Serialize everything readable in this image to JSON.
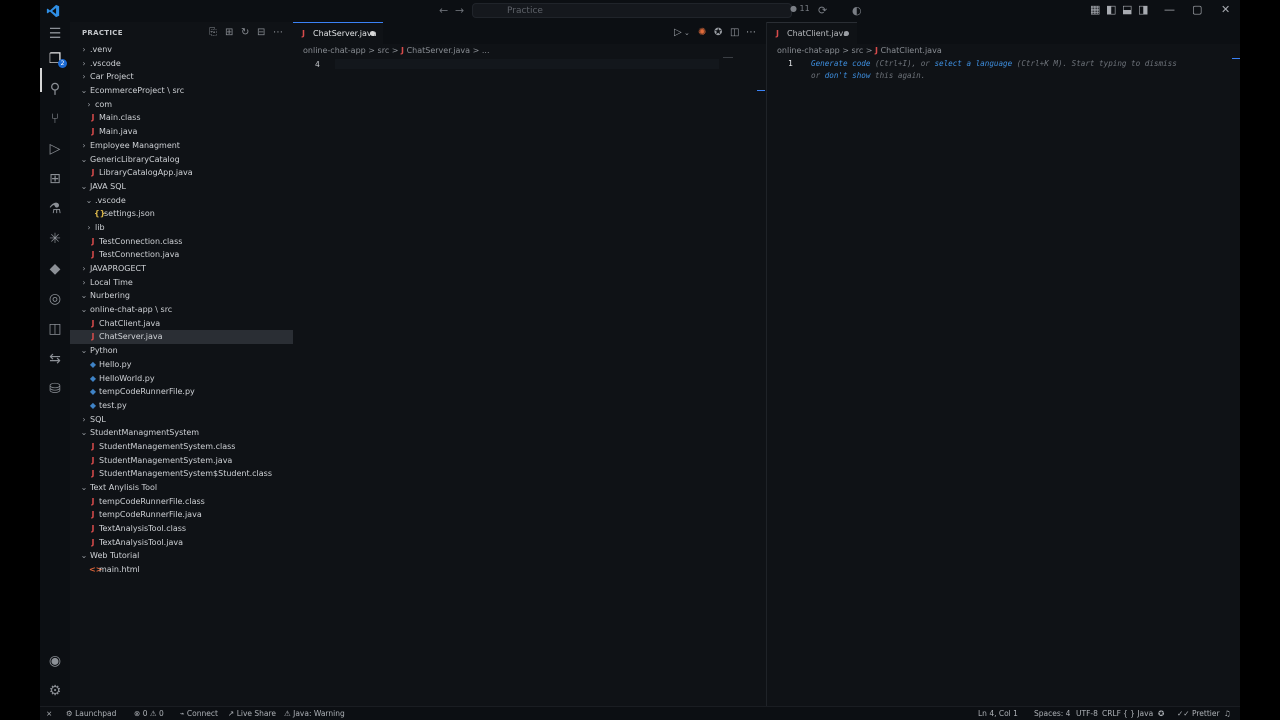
{
  "titlebar": {
    "search_placeholder": "Practice",
    "notifications_count": "11"
  },
  "sidebar": {
    "title": "PRACTICE",
    "items": [
      {
        "label": ".venv",
        "type": "folder",
        "state": "closed",
        "depth": 0
      },
      {
        "label": ".vscode",
        "type": "folder",
        "state": "closed",
        "depth": 0
      },
      {
        "label": "Car Project",
        "type": "folder",
        "state": "closed",
        "depth": 0
      },
      {
        "label": "EcommerceProject \\ src",
        "type": "folder",
        "state": "open",
        "depth": 0
      },
      {
        "label": "com",
        "type": "folder",
        "state": "closed",
        "depth": 1
      },
      {
        "label": "Main.class",
        "type": "java",
        "depth": 1
      },
      {
        "label": "Main.java",
        "type": "java",
        "depth": 1
      },
      {
        "label": "Employee Managment",
        "type": "folder",
        "state": "closed",
        "depth": 0
      },
      {
        "label": "GenericLibraryCatalog",
        "type": "folder",
        "state": "open",
        "depth": 0
      },
      {
        "label": "LibraryCatalogApp.java",
        "type": "java",
        "depth": 1
      },
      {
        "label": "JAVA SQL",
        "type": "folder",
        "state": "open",
        "depth": 0
      },
      {
        "label": ".vscode",
        "type": "folder",
        "state": "open",
        "depth": 1
      },
      {
        "label": "settings.json",
        "type": "json",
        "depth": 2
      },
      {
        "label": "lib",
        "type": "folder",
        "state": "closed",
        "depth": 1
      },
      {
        "label": "TestConnection.class",
        "type": "java",
        "depth": 1
      },
      {
        "label": "TestConnection.java",
        "type": "java",
        "depth": 1
      },
      {
        "label": "JAVAPROGECT",
        "type": "folder",
        "state": "closed",
        "depth": 0
      },
      {
        "label": "Local Time",
        "type": "folder",
        "state": "closed",
        "depth": 0
      },
      {
        "label": "Nurbering",
        "type": "folder",
        "state": "open",
        "depth": 0
      },
      {
        "label": "online-chat-app \\ src",
        "type": "folder",
        "state": "open",
        "depth": 0
      },
      {
        "label": "ChatClient.java",
        "type": "java",
        "depth": 1
      },
      {
        "label": "ChatServer.java",
        "type": "java",
        "depth": 1,
        "selected": true
      },
      {
        "label": "Python",
        "type": "folder",
        "state": "open",
        "depth": 0
      },
      {
        "label": "Hello.py",
        "type": "py",
        "depth": 1
      },
      {
        "label": "HelloWorld.py",
        "type": "py",
        "depth": 1
      },
      {
        "label": "tempCodeRunnerFile.py",
        "type": "py",
        "depth": 1
      },
      {
        "label": "test.py",
        "type": "py",
        "depth": 1
      },
      {
        "label": "SQL",
        "type": "folder",
        "state": "closed",
        "depth": 0
      },
      {
        "label": "StudentManagmentSystem",
        "type": "folder",
        "state": "open",
        "depth": 0
      },
      {
        "label": "StudentManagementSystem.class",
        "type": "java",
        "depth": 1
      },
      {
        "label": "StudentManagementSystem.java",
        "type": "java",
        "depth": 1
      },
      {
        "label": "StudentManagementSystem$Student.class",
        "type": "java",
        "depth": 1
      },
      {
        "label": "Text Anylisis Tool",
        "type": "folder",
        "state": "open",
        "depth": 0
      },
      {
        "label": "tempCodeRunnerFile.class",
        "type": "java",
        "depth": 1
      },
      {
        "label": "tempCodeRunnerFile.java",
        "type": "java",
        "depth": 1
      },
      {
        "label": "TextAnalysisTool.class",
        "type": "java",
        "depth": 1
      },
      {
        "label": "TextAnalysisTool.java",
        "type": "java",
        "depth": 1
      },
      {
        "label": "Web Tutorial",
        "type": "folder",
        "state": "open",
        "depth": 0
      },
      {
        "label": "main.html",
        "type": "html",
        "depth": 1
      }
    ]
  },
  "editor_left": {
    "tab_label": "ChatServer.java",
    "tab_icon": "J",
    "breadcrumb": {
      "seg1": "online-chat-app",
      "seg2": "src",
      "file": "ChatServer.java",
      "tail": "..."
    },
    "line_number": "4"
  },
  "editor_right": {
    "tab_label": "ChatClient.java",
    "tab_icon": "J",
    "breadcrumb": {
      "seg1": "online-chat-app",
      "seg2": "src",
      "file": "ChatClient.java"
    },
    "line_number": "1",
    "hint": {
      "link1": "Generate code",
      "text1": " (Ctrl+I), or ",
      "link2": "select a language",
      "text2": " (Ctrl+K M). Start typing to dismiss",
      "text3": "or ",
      "link3": "don't show",
      "text4": " this again."
    }
  },
  "statusbar": {
    "launchpad": "Launchpad",
    "errors": "0",
    "warnings": "0",
    "connect": "Connect",
    "live_share": "Live Share",
    "java_status": "Java: Warning",
    "position": "Ln 4, Col 1",
    "spaces": "Spaces: 4",
    "encoding": "UTF-8",
    "eol": "CRLF",
    "language": "Java",
    "prettier": "Prettier"
  },
  "colors": {
    "accent": "#3b82f6",
    "java_icon": "#d84b4b",
    "python_icon": "#3f83c6",
    "json_icon": "#d9b54a",
    "html_icon": "#e0663a"
  }
}
